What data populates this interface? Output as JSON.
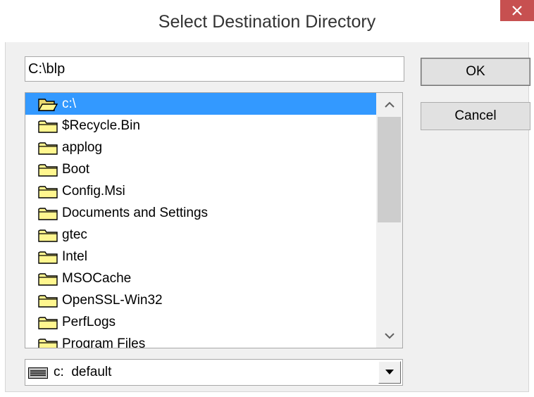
{
  "window": {
    "title": "Select Destination Directory",
    "close_symbol": "×"
  },
  "path_input": {
    "value": "C:\\blp"
  },
  "buttons": {
    "ok_label": "OK",
    "cancel_label": "Cancel"
  },
  "folder_list": {
    "items": [
      {
        "label": "c:\\",
        "icon": "open-folder-icon",
        "selected": true
      },
      {
        "label": "$Recycle.Bin",
        "icon": "folder-icon"
      },
      {
        "label": "applog",
        "icon": "folder-icon"
      },
      {
        "label": "Boot",
        "icon": "folder-icon"
      },
      {
        "label": "Config.Msi",
        "icon": "folder-icon"
      },
      {
        "label": "Documents and Settings",
        "icon": "folder-icon"
      },
      {
        "label": "gtec",
        "icon": "folder-icon"
      },
      {
        "label": "Intel",
        "icon": "folder-icon"
      },
      {
        "label": "MSOCache",
        "icon": "folder-icon"
      },
      {
        "label": "OpenSSL-Win32",
        "icon": "folder-icon"
      },
      {
        "label": "PerfLogs",
        "icon": "folder-icon"
      },
      {
        "label": "Program Files",
        "icon": "folder-icon"
      }
    ]
  },
  "drive_select": {
    "value": "c:  default",
    "icon": "drive-icon"
  },
  "colors": {
    "selection": "#3399ff",
    "close_button": "#c75050",
    "folder_fill": "#fff68f",
    "dialog_bg": "#f0f0f0"
  }
}
